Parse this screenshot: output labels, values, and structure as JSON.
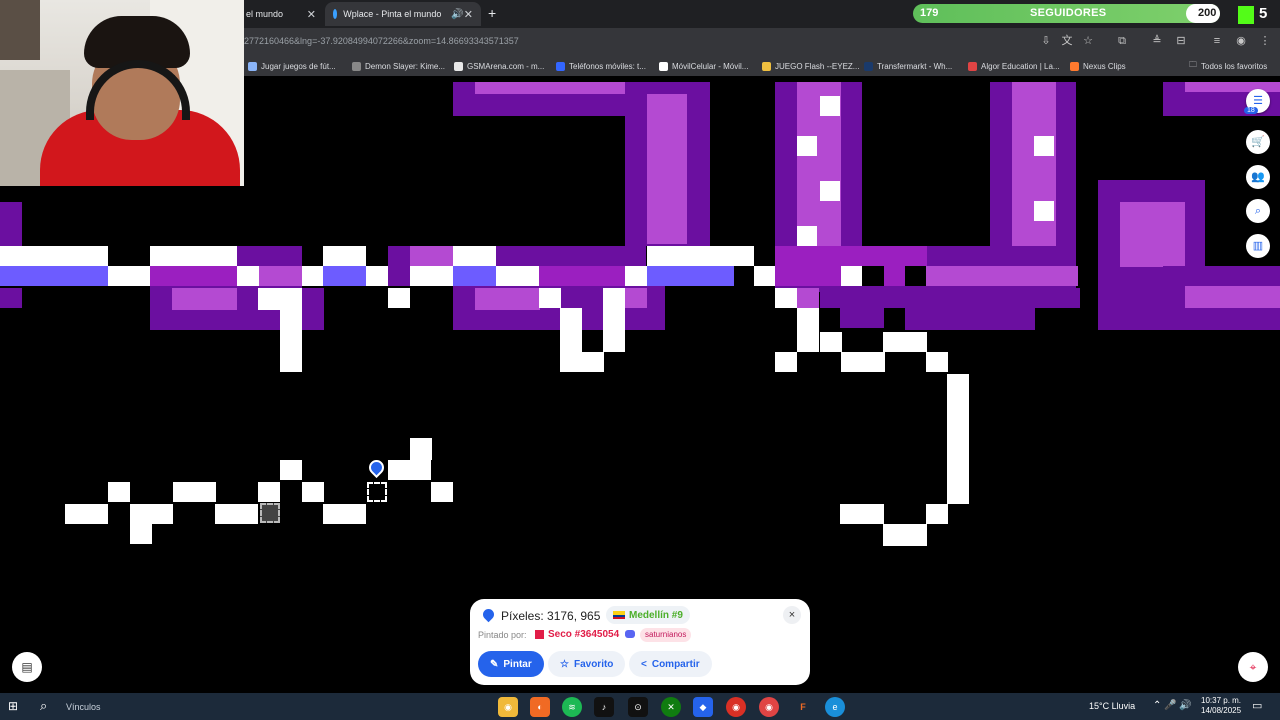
{
  "browser": {
    "tabs": [
      {
        "title": "el mundo"
      },
      {
        "title": "Wplace - Pinta el mundo",
        "close": "✕"
      }
    ],
    "tab_close": "✕",
    "new_tab": "+",
    "url": "2772160466&lng=-37.92084994072266&zoom=14.86693343571357",
    "bookmarks": [
      {
        "label": "Jugar juegos de fút...",
        "color": "#8ab4f8"
      },
      {
        "label": "Demon Slayer: Kime...",
        "color": "#888888"
      },
      {
        "label": "GSMArena.com - m...",
        "color": "#e8e8e8"
      },
      {
        "label": "Teléfonos móviles: t...",
        "color": "#3366ff"
      },
      {
        "label": "MóvilCelular - Móvil...",
        "color": "#ffffff"
      },
      {
        "label": "JUEGO Flash --EYEZ...",
        "color": "#f0c040"
      },
      {
        "label": "Transfermarkt - Wh...",
        "color": "#1a3a6b"
      },
      {
        "label": "Algor Education | La...",
        "color": "#e04444"
      },
      {
        "label": "Nexus Clips",
        "color": "#ff7a2e"
      }
    ],
    "all_bookmarks": "Todos los favoritos"
  },
  "stream": {
    "followers_current": "179",
    "followers_label": "SEGUIDORES",
    "followers_goal": "200",
    "followers_progress": 0.895,
    "kick_count": "5",
    "kick_color": "#53fc18"
  },
  "canvas": {
    "colors": {
      "purple_dark": "#6b0fa0",
      "purple_mid": "#9b1fc0",
      "purple_light": "#b44ad2",
      "indigo": "#6d5cff",
      "white": "#ffffff"
    }
  },
  "tools": {
    "badge": "18",
    "icons": [
      "user-menu-icon",
      "shop-icon",
      "group-icon",
      "search-icon",
      "leaderboard-icon"
    ]
  },
  "panel": {
    "pixels_label": "Píxeles: 3176, 965",
    "region": "Medellín #9",
    "painted_by_label": "Pintado por:",
    "painter": "Seco #3645054",
    "clan": "saturnianos",
    "close": "×",
    "paint_label": "Pintar",
    "favorite_label": "Favorito",
    "share_label": "Compartir"
  },
  "taskbar": {
    "search_label": "Vínculos",
    "weather": "15°C  Lluvia",
    "time": "10:37 p. m.",
    "date": "14/08/2025",
    "apps": [
      "chrome-icon",
      "origin-icon",
      "spotify-icon",
      "tiktok-icon",
      "steam-icon",
      "xbox-icon",
      "roblox-icon",
      "chrome2-icon",
      "chrome3-icon",
      "fl-icon",
      "edge-icon"
    ]
  }
}
